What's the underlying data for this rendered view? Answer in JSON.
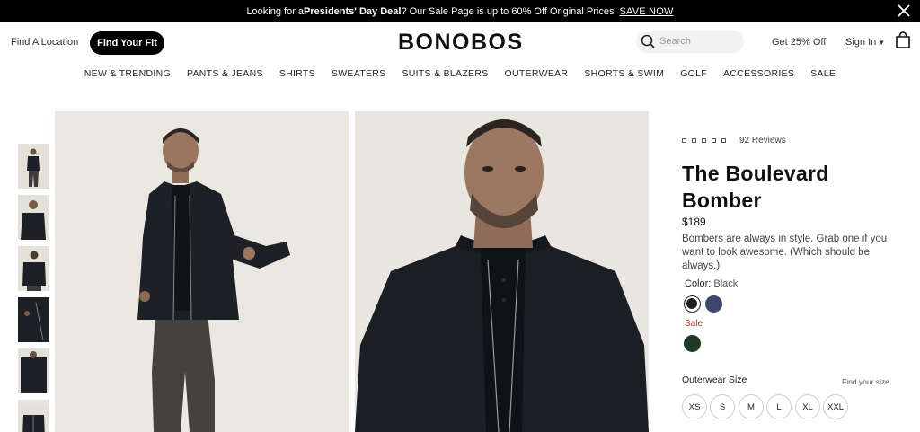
{
  "promo": {
    "prefix": "Looking for a ",
    "highlight": "Presidents' Day Deal",
    "suffix": "? Our Sale Page is up to 60% Off Original Prices",
    "link": "SAVE NOW",
    "close_icon": "close-icon"
  },
  "header": {
    "find_location": "Find A Location",
    "find_fit": "Find Your Fit",
    "logo": "BONOBOS",
    "search_placeholder": "Search",
    "get_off": "Get 25% Off",
    "sign_in": "Sign In",
    "bag_icon": "shopping-bag-icon"
  },
  "nav": {
    "items": [
      {
        "label": "NEW & TRENDING"
      },
      {
        "label": "PANTS & JEANS"
      },
      {
        "label": "SHIRTS"
      },
      {
        "label": "SWEATERS"
      },
      {
        "label": "SUITS & BLAZERS"
      },
      {
        "label": "OUTERWEAR"
      },
      {
        "label": "SHORTS & SWIM"
      },
      {
        "label": "GOLF"
      },
      {
        "label": "ACCESSORIES"
      },
      {
        "label": "SALE"
      }
    ]
  },
  "product": {
    "reviews": "92 Reviews",
    "title": "The Boulevard Bomber",
    "price": "$189",
    "description": "Bombers are always in style. Grab one if you want to look awesome. (Which should be always.)",
    "color_label": "Color:",
    "color_value": "Black",
    "sale_label": "Sale",
    "swatch_colors": {
      "black": "#1c1f22",
      "navy": "#3f466e",
      "green": "#1e3a26"
    },
    "size_label": "Outerwear Size",
    "find_size": "Find your size",
    "sizes": [
      "XS",
      "S",
      "M",
      "L",
      "XL",
      "XXL"
    ]
  }
}
